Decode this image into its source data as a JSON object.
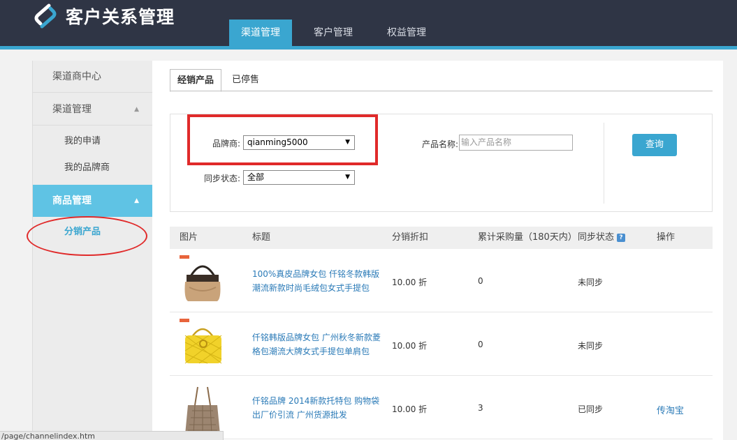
{
  "header": {
    "app_title": "客户关系管理",
    "nav": [
      "渠道管理",
      "客户管理",
      "权益管理"
    ]
  },
  "sidebar": {
    "items": [
      {
        "label": "渠道商中心"
      },
      {
        "label": "渠道管理"
      },
      {
        "label": "我的申请"
      },
      {
        "label": "我的品牌商"
      },
      {
        "label": "商品管理"
      },
      {
        "label": "分销产品"
      }
    ]
  },
  "content": {
    "tabs": [
      "经销产品",
      "已停售"
    ],
    "filter": {
      "brand_label": "品牌商:",
      "brand_value": "qianming5000",
      "sync_label": "同步状态:",
      "sync_value": "全部",
      "product_label": "产品名称:",
      "product_placeholder": "输入产品名称",
      "query_label": "查询"
    },
    "table": {
      "headers": [
        "图片",
        "标题",
        "分销折扣",
        "累计采购量（180天内）",
        "同步状态",
        "操作"
      ],
      "rows": [
        {
          "title": "100%真皮品牌女包 仟铭冬款韩版潮流新款时尚毛绒包女式手提包",
          "discount": "10.00 折",
          "purchases": "0",
          "status": "未同步",
          "action": ""
        },
        {
          "title": "仟铭韩版品牌女包 广州秋冬新款菱格包潮流大牌女式手提包单肩包",
          "discount": "10.00 折",
          "purchases": "0",
          "status": "未同步",
          "action": ""
        },
        {
          "title": "仟铭品牌 2014新款托特包 购物袋 出厂价引流 广州货源批发",
          "discount": "10.00 折",
          "purchases": "3",
          "status": "已同步",
          "action": "传淘宝"
        }
      ]
    }
  },
  "status_bar": "/page/channelindex.htm",
  "colors": {
    "header_bg": "#2f3545",
    "accent": "#3aa6d0",
    "highlight": "#e02a2a",
    "link": "#2a7ab7"
  }
}
